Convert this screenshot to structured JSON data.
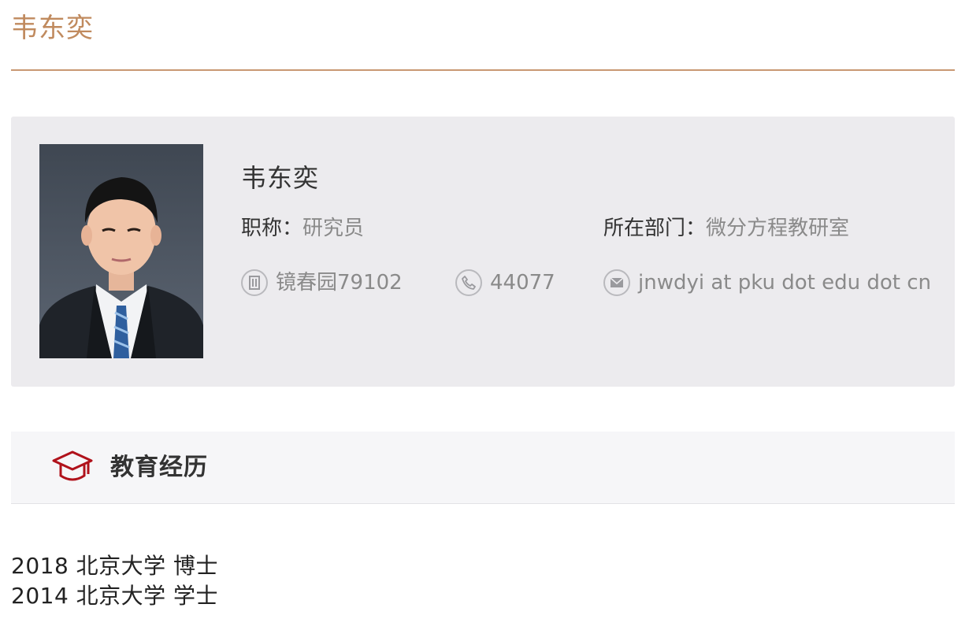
{
  "header": {
    "title": "韦东奕"
  },
  "profile": {
    "name": "韦东奕",
    "title_label": "职称：",
    "title_value": "研究员",
    "dept_label": "所在部门：",
    "dept_value": "微分方程教研室",
    "office": "镜春园79102",
    "phone": "44077",
    "email": "jnwdyi at pku dot edu dot cn"
  },
  "education": {
    "heading": "教育经历",
    "items": [
      "2018 北京大学 博士",
      "2014 北京大学 学士"
    ]
  },
  "colors": {
    "title_accent": "#c08a5e",
    "rule": "#c99873",
    "card_bg": "#ecebee",
    "icon_red": "#b0121b"
  },
  "icons": {
    "office": "building-icon",
    "phone": "phone-icon",
    "email": "mail-icon",
    "education": "graduation-cap-icon"
  }
}
